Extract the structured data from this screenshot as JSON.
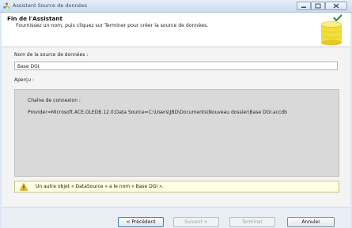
{
  "window": {
    "title": "Assistant Source de données"
  },
  "header": {
    "title": "Fin de l'Assistant",
    "subtitle": "Fournissez un nom, puis cliquez sur Terminer pour créer la source de données."
  },
  "form": {
    "name_label": "Nom de la source de données :",
    "name_value": "Base DGI",
    "preview_label": "Aperçu :",
    "connection_label": "Chaîne de connexion :",
    "connection_string": "Provider=Microsoft.ACE.OLEDB.12.0;Data Source=C:\\Users\\JBD\\Documents\\Nouveau dossier\\Base DGI.accdb"
  },
  "warning": {
    "text": "Un autre objet « DataSource » a le nom « Base DGI »."
  },
  "buttons": {
    "previous": "< Précédent",
    "next": "Suivant >",
    "finish": "Terminer",
    "cancel": "Annuler"
  },
  "icons": {
    "app": "wizard-icon",
    "header": "database-icon",
    "warning": "warning-icon"
  },
  "colors": {
    "titlebar": "#dbe7f4",
    "warning_bg": "#ffffe1",
    "preview_bg": "#d9d9d9",
    "db_yellow": "#f2de3a"
  }
}
